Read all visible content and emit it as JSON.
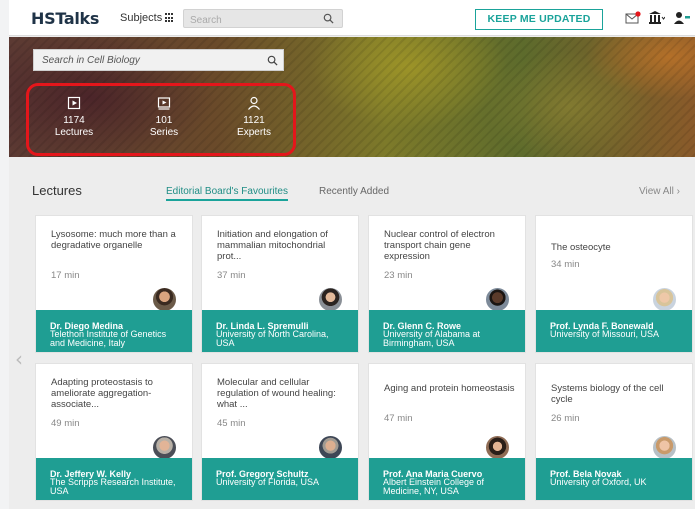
{
  "header": {
    "logo": "HSTalks",
    "subjects_label": "Subjects",
    "search_placeholder": "Search",
    "keep_updated_label": "KEEP ME UPDATED"
  },
  "hero": {
    "search_placeholder": "Search in Cell Biology",
    "stats": [
      {
        "value": "1174",
        "label": "Lectures",
        "icon": "lecture-icon"
      },
      {
        "value": "101",
        "label": "Series",
        "icon": "series-icon"
      },
      {
        "value": "1121",
        "label": "Experts",
        "icon": "expert-icon"
      }
    ]
  },
  "lectures": {
    "heading": "Lectures",
    "tabs": [
      "Editorial Board's Favourites",
      "Recently Added"
    ],
    "view_all": "View All ›",
    "cards": [
      {
        "title": "Lysosome: much more than a degradative organelle",
        "duration": "17 min",
        "speaker": "Dr. Diego Medina",
        "affiliation": "Telethon Institute of Genetics and Medicine, Italy"
      },
      {
        "title": "Initiation and elongation of mammalian mitochondrial prot...",
        "duration": "37 min",
        "speaker": "Dr. Linda L. Spremulli",
        "affiliation": "University of North Carolina, USA"
      },
      {
        "title": "Nuclear control of electron transport chain gene expression",
        "duration": "23 min",
        "speaker": "Dr. Glenn C. Rowe",
        "affiliation": "University of Alabama at Birmingham, USA"
      },
      {
        "title": "The osteocyte",
        "duration": "34 min",
        "speaker": "Prof. Lynda F. Bonewald",
        "affiliation": "University of Missouri, USA"
      },
      {
        "title": "Adapting proteostasis to ameliorate aggregation-associate...",
        "duration": "49 min",
        "speaker": "Dr. Jeffery W. Kelly",
        "affiliation": "The Scripps Research Institute, USA"
      },
      {
        "title": "Molecular and cellular regulation of wound healing: what ...",
        "duration": "45 min",
        "speaker": "Prof. Gregory Schultz",
        "affiliation": "University of Florida, USA"
      },
      {
        "title": "Aging and protein homeostasis",
        "duration": "47 min",
        "speaker": "Prof. Ana Maria Cuervo",
        "affiliation": "Albert Einstein College of Medicine, NY, USA"
      },
      {
        "title": "Systems biology of the cell cycle",
        "duration": "26 min",
        "speaker": "Prof. Bela Novak",
        "affiliation": "University of Oxford, UK"
      }
    ]
  },
  "colors": {
    "brand_teal": "#1f9e93",
    "highlight_red": "#e4161b",
    "logo_navy": "#1f3347"
  }
}
